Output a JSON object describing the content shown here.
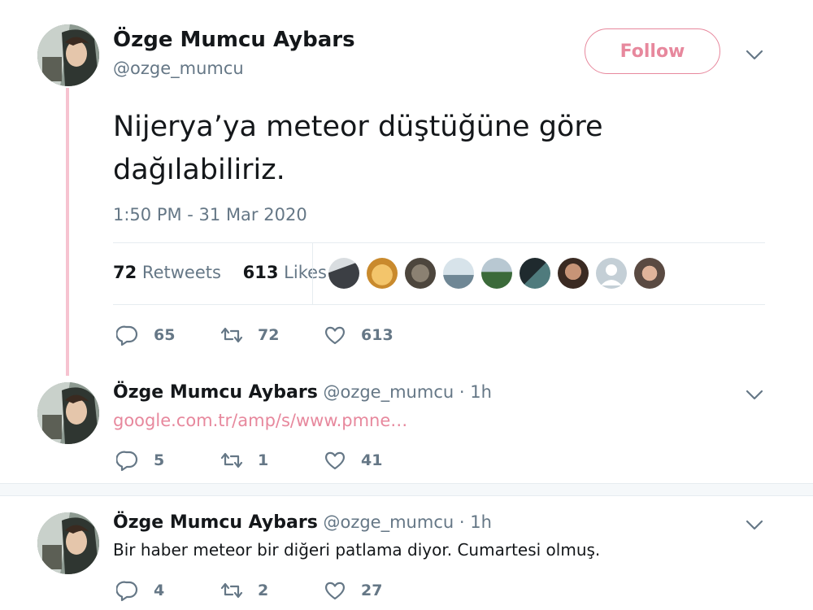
{
  "main_tweet": {
    "author_name": "Özge Mumcu Aybars",
    "author_handle": "@ozge_mumcu",
    "follow_label": "Follow",
    "text_line1": "Nijerya’ya meteor düştüğüne göre",
    "text_line2": "dağılabiliriz.",
    "timestamp": "1:50 PM - 31 Mar 2020",
    "retweets_count": "72",
    "retweets_label": "Retweets",
    "likes_count": "613",
    "likes_label": "Likes",
    "actions": {
      "replies": "65",
      "retweets": "72",
      "likes": "613"
    }
  },
  "replies": [
    {
      "author_name": "Özge Mumcu Aybars",
      "author_handle": "@ozge_mumcu",
      "separator": "·",
      "time": "1h",
      "link_text": "google.com.tr/amp/s/www.pmne…",
      "actions": {
        "replies": "5",
        "retweets": "1",
        "likes": "41"
      }
    },
    {
      "author_name": "Özge Mumcu Aybars",
      "author_handle": "@ozge_mumcu",
      "separator": "·",
      "time": "1h",
      "text": "Bir haber meteor bir diğeri patlama diyor. Cumartesi olmuş.",
      "actions": {
        "replies": "4",
        "retweets": "2",
        "likes": "27"
      }
    }
  ],
  "colors": {
    "accent_pink": "#e7889d",
    "thread_line": "#f6c3d0",
    "muted": "#657786",
    "text": "#14171a"
  },
  "icons": [
    "reply-icon",
    "retweet-icon",
    "like-icon",
    "chevron-down-icon"
  ]
}
